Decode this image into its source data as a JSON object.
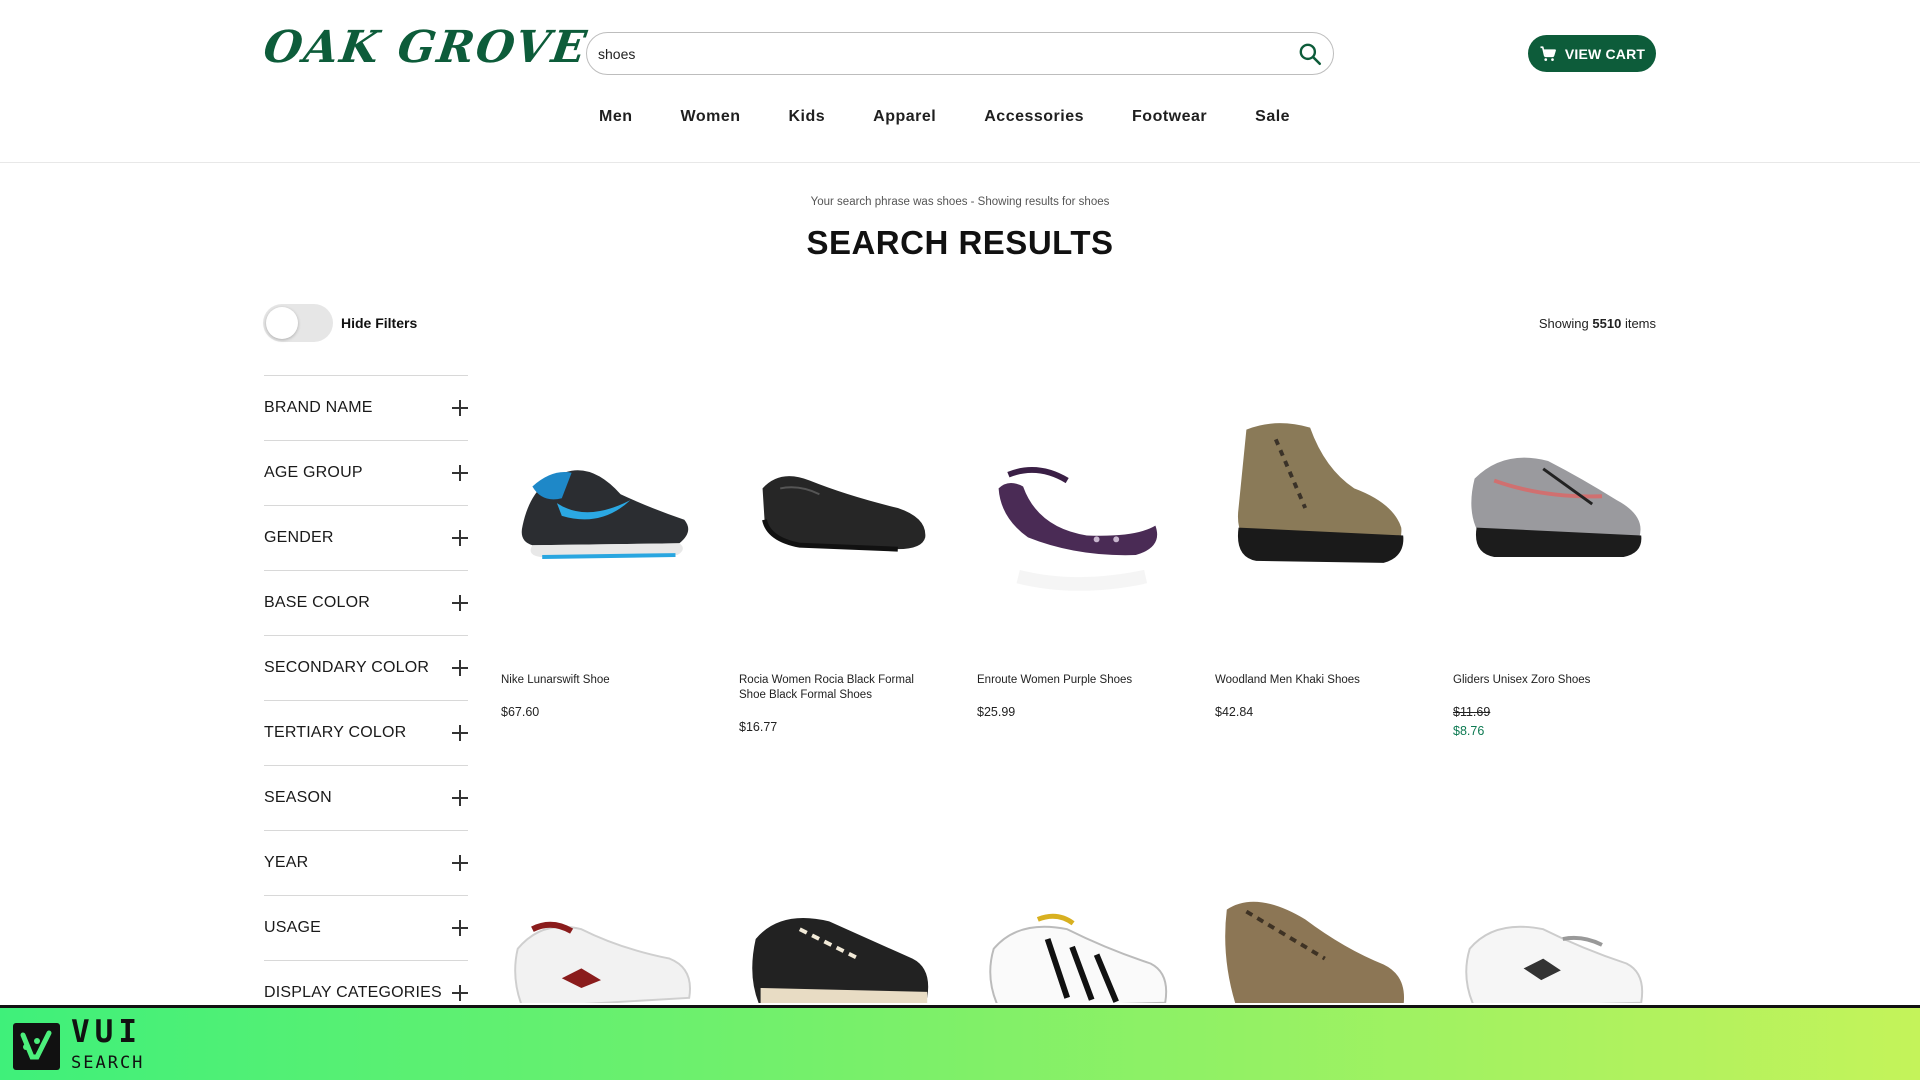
{
  "header": {
    "logo": "OAK GROVE",
    "search_value": "shoes",
    "search_placeholder": "Search",
    "cart_label": "VIEW CART",
    "nav": [
      "Men",
      "Women",
      "Kids",
      "Apparel",
      "Accessories",
      "Footwear",
      "Sale"
    ]
  },
  "results": {
    "phrase": "Your search phrase was shoes - Showing results for shoes",
    "title": "SEARCH RESULTS",
    "toggle_label": "Hide Filters",
    "count_prefix": "Showing",
    "count": "5510",
    "count_suffix": "items"
  },
  "filters": [
    "BRAND NAME",
    "AGE GROUP",
    "GENDER",
    "BASE COLOR",
    "SECONDARY COLOR",
    "TERTIARY COLOR",
    "SEASON",
    "YEAR",
    "USAGE",
    "DISPLAY CATEGORIES"
  ],
  "products": [
    {
      "name": "Nike Lunarswift Shoe",
      "price": "$67.60"
    },
    {
      "name": "Rocia Women Rocia Black Formal Shoe Black Formal Shoes",
      "price": "$16.77"
    },
    {
      "name": "Enroute Women Purple Shoes",
      "price": "$25.99"
    },
    {
      "name": "Woodland Men Khaki Shoes",
      "price": "$42.84"
    },
    {
      "name": "Gliders Unisex Zoro Shoes",
      "old_price": "$11.69",
      "price": "$8.76"
    }
  ],
  "footer": {
    "brand": "VUI",
    "sub": "SEARCH"
  },
  "colors": {
    "brand_green": "#0d5c3a",
    "sale_green": "#0d7a52"
  }
}
